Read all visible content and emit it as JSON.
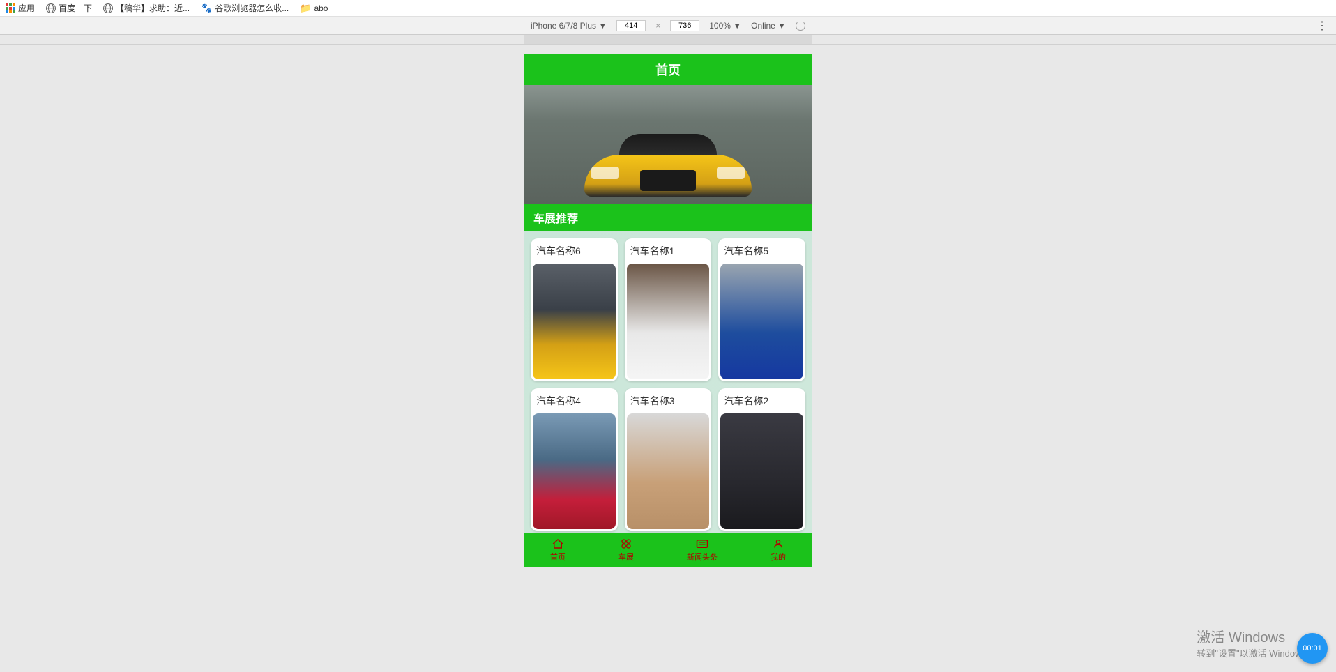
{
  "bookmarks": {
    "apps": "应用",
    "baidu": "百度一下",
    "help": "【稿华】求助：近...",
    "google_fav": "谷歌浏览器怎么收...",
    "abo": "abo"
  },
  "devtools": {
    "device": "iPhone 6/7/8 Plus ▼",
    "width": "414",
    "height": "736",
    "zoom": "100% ▼",
    "network": "Online ▼"
  },
  "app": {
    "header_title": "首页",
    "section_title": "车展推荐",
    "cards": [
      {
        "title": "汽车名称6"
      },
      {
        "title": "汽车名称1"
      },
      {
        "title": "汽车名称5"
      },
      {
        "title": "汽车名称4"
      },
      {
        "title": "汽车名称3"
      },
      {
        "title": "汽车名称2"
      }
    ],
    "nav": {
      "home": "首页",
      "car_show": "车展",
      "news": "新闻头条",
      "mine": "我的"
    }
  },
  "windows": {
    "line1": "激活 Windows",
    "line2": "转到\"设置\"以激活 Windows。"
  },
  "timer": "00:01"
}
